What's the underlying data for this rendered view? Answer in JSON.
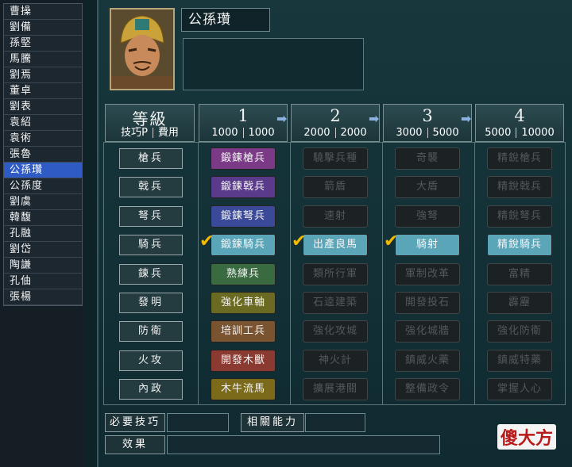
{
  "sidebar": {
    "officers": [
      {
        "label": "曹操"
      },
      {
        "label": "劉備"
      },
      {
        "label": "孫堅"
      },
      {
        "label": "馬騰"
      },
      {
        "label": "劉焉"
      },
      {
        "label": "董卓"
      },
      {
        "label": "劉表"
      },
      {
        "label": "袁紹"
      },
      {
        "label": "袁術"
      },
      {
        "label": "張魯"
      },
      {
        "label": "公孫瓚"
      },
      {
        "label": "公孫度"
      },
      {
        "label": "劉虞"
      },
      {
        "label": "韓馥"
      },
      {
        "label": "孔融"
      },
      {
        "label": "劉岱"
      },
      {
        "label": "陶謙"
      },
      {
        "label": "孔伷"
      },
      {
        "label": "張楊"
      }
    ],
    "selected_index": 10
  },
  "officer": {
    "name": "公孫瓚",
    "portrait_icon": "officer-portrait"
  },
  "header": {
    "level_label": "等級",
    "tech_cost_label": "技巧P",
    "cost_label": "費用",
    "levels": [
      {
        "num": "1",
        "tech": "1000",
        "cost": "1000"
      },
      {
        "num": "2",
        "tech": "2000",
        "cost": "2000"
      },
      {
        "num": "3",
        "tech": "3000",
        "cost": "5000"
      },
      {
        "num": "4",
        "tech": "5000",
        "cost": "10000"
      }
    ],
    "arrow_glyph": "➡"
  },
  "rows": [
    {
      "label": "槍兵",
      "cells": [
        "鍛鍊槍兵",
        "驍擊兵種",
        "奇襲",
        "精銳槍兵"
      ]
    },
    {
      "label": "戟兵",
      "cells": [
        "鍛鍊戟兵",
        "箭盾",
        "大盾",
        "精銳戟兵"
      ]
    },
    {
      "label": "弩兵",
      "cells": [
        "鍛鍊弩兵",
        "速射",
        "強弩",
        "精銳弩兵"
      ]
    },
    {
      "label": "騎兵",
      "cells": [
        "鍛鍊騎兵",
        "出產良馬",
        "騎射",
        "精銳騎兵"
      ]
    },
    {
      "label": "鍊兵",
      "cells": [
        "熟練兵",
        "類所行軍",
        "軍制改革",
        "富精"
      ]
    },
    {
      "label": "發明",
      "cells": [
        "強化車軸",
        "石逵建築",
        "開發投石",
        "霹靂"
      ]
    },
    {
      "label": "防衛",
      "cells": [
        "培訓工兵",
        "強化攻城",
        "強化城牆",
        "強化防衛"
      ]
    },
    {
      "label": "火攻",
      "cells": [
        "開發木獸",
        "神火計",
        "鎮威火藥",
        "鎮威特藥"
      ]
    },
    {
      "label": "內政",
      "cells": [
        "木牛流馬",
        "擴展港關",
        "整備政令",
        "掌握人心"
      ]
    }
  ],
  "cell_styles": {
    "level1_colors": [
      "#7a3a86",
      "#5a3a8a",
      "#3a4a98",
      "#5aa6b8",
      "#3a6a40",
      "#6a6a22",
      "#7a5430",
      "#8a3a30",
      "#7a6a1a"
    ],
    "researched_color": "#5aa6b8",
    "locked_color": "#1c2224"
  },
  "researched": [
    [
      3,
      0
    ],
    [
      3,
      1
    ],
    [
      3,
      2
    ],
    [
      3,
      3
    ]
  ],
  "checkmarks": [
    [
      3,
      0
    ],
    [
      3,
      1
    ],
    [
      3,
      2
    ]
  ],
  "footer": {
    "required_skill_label": "必要技巧",
    "related_ability_label": "相關能力",
    "effect_label": "效果"
  },
  "watermark": "傻大方"
}
